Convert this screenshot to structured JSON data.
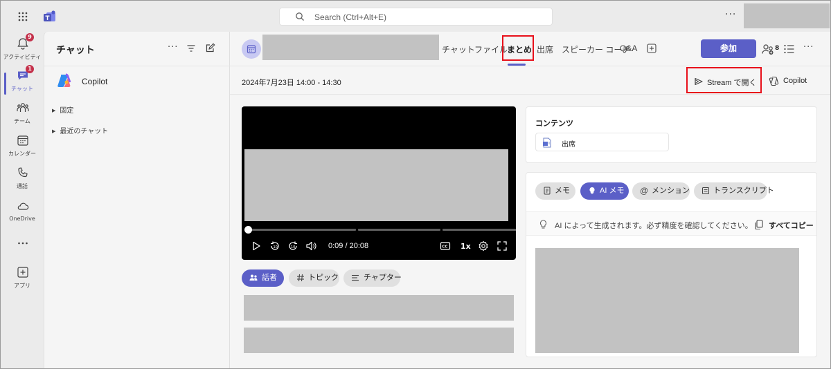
{
  "search": {
    "placeholder": "Search (Ctrl+Alt+E)"
  },
  "rail": {
    "items": [
      {
        "label": "アクティビティ",
        "icon": "bell-icon",
        "badge": "9"
      },
      {
        "label": "チャット",
        "icon": "chat-icon",
        "badge": "1",
        "active": true
      },
      {
        "label": "チーム",
        "icon": "teams-icon"
      },
      {
        "label": "カレンダー",
        "icon": "calendar-icon"
      },
      {
        "label": "通話",
        "icon": "phone-icon"
      },
      {
        "label": "OneDrive",
        "icon": "cloud-icon"
      },
      {
        "label": "",
        "icon": "more-icon"
      },
      {
        "label": "アプリ",
        "icon": "add-app-icon"
      }
    ]
  },
  "chatlist": {
    "title": "チャット",
    "copilot_label": "Copilot",
    "sections": [
      "固定",
      "最近のチャット"
    ]
  },
  "meeting": {
    "tabs": [
      "チャット",
      "ファイル",
      "まとめ",
      "出席",
      "スピーカー コーチ",
      "Q&A"
    ],
    "active_tab": "まとめ",
    "join_label": "参加",
    "participant_count": "8",
    "datetime": "2024年7月23日 14:00 - 14:30",
    "stream_label": "Stream で開く",
    "copilot_label": "Copilot"
  },
  "video": {
    "time": "0:09 / 20:08",
    "speed": "1x",
    "progress": 0.0075
  },
  "recap_tabs": [
    "話者",
    "トピック",
    "チャプター"
  ],
  "contents": {
    "title": "コンテンツ",
    "attachment": "出席"
  },
  "notes": {
    "tabs": [
      "メモ",
      "AI メモ",
      "メンション",
      "トランスクリプト"
    ],
    "active": "AI メモ",
    "notice": "AI によって生成されます。必ず精度を確認してください。",
    "copy_all": "すべてコピー"
  },
  "colors": {
    "accent": "#5b5fc7",
    "highlight": "#e8101a",
    "badge": "#c4314b"
  }
}
